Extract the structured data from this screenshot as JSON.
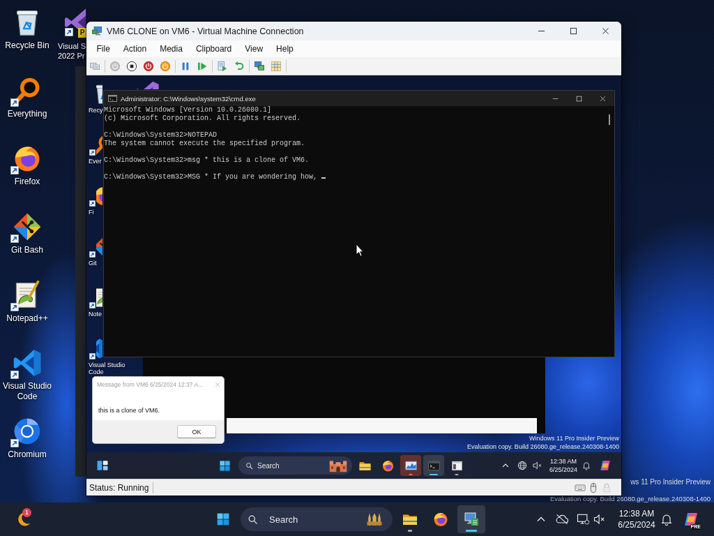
{
  "desktop": {
    "icons": [
      {
        "kind": "recycle-bin",
        "label": "Recycle Bin",
        "shortcut": false
      },
      {
        "kind": "everything",
        "label": "Everything",
        "shortcut": true
      },
      {
        "kind": "firefox",
        "label": "Firefox",
        "shortcut": true
      },
      {
        "kind": "git",
        "label": "Git Bash",
        "shortcut": true
      },
      {
        "kind": "notepad",
        "label": "Notepad++",
        "shortcut": true
      },
      {
        "kind": "vscode",
        "label": "Visual Studio Code",
        "shortcut": true
      },
      {
        "kind": "chromium",
        "label": "Chromium",
        "shortcut": true
      }
    ],
    "covered_icon": {
      "kind": "visual-studio",
      "label_lines": [
        "Visual S",
        "2022 Pr"
      ],
      "badge": "P",
      "shortcut": true
    },
    "watermark": [
      "ws 11 Pro Insider Preview",
      "Evaluation copy. Build 26080.ge_release.240308-1400"
    ]
  },
  "vm_window": {
    "title": "VM6 CLONE on VM6 - Virtual Machine Connection",
    "menu": [
      "File",
      "Action",
      "Media",
      "Clipboard",
      "View",
      "Help"
    ],
    "toolbar": [
      [
        {
          "kind": "ctrl-alt-del",
          "disabled": false
        }
      ],
      [
        {
          "kind": "start",
          "disabled": true
        },
        {
          "kind": "turn-off",
          "disabled": false
        },
        {
          "kind": "shut-down",
          "disabled": false
        },
        {
          "kind": "save",
          "disabled": false
        }
      ],
      [
        {
          "kind": "pause",
          "disabled": false
        },
        {
          "kind": "resume",
          "disabled": false
        }
      ],
      [
        {
          "kind": "checkpoint",
          "disabled": false
        },
        {
          "kind": "revert",
          "disabled": false
        }
      ],
      [
        {
          "kind": "enhanced-session",
          "disabled": false
        },
        {
          "kind": "zoom",
          "disabled": false
        }
      ]
    ],
    "status": "Status: Running",
    "status_icons": [
      {
        "kind": "keyboard",
        "disabled": false
      },
      {
        "kind": "mouse",
        "disabled": false
      },
      {
        "kind": "lock",
        "disabled": true
      }
    ]
  },
  "guest": {
    "icons": [
      {
        "kind": "recycle-bin",
        "label": "Recy",
        "shortcut": false
      },
      {
        "kind": "everything",
        "label": "Ever",
        "shortcut": true
      },
      {
        "kind": "firefox",
        "label": "Fi",
        "shortcut": true
      },
      {
        "kind": "git",
        "label": "Git",
        "shortcut": true
      },
      {
        "kind": "notepad",
        "label": "Note",
        "shortcut": true
      },
      {
        "kind": "vscode",
        "label": "Visual Studio Code",
        "shortcut": true
      }
    ],
    "covered_icon": {
      "kind": "visual-studio"
    },
    "cmd": {
      "title": "Administrator: C:\\Windows\\system32\\cmd.exe",
      "blocks": [
        [
          "Microsoft Windows [Version 10.0.26080.1]",
          "(c) Microsoft Corporation. All rights reserved."
        ],
        [
          "C:\\Windows\\System32>NOTEPAD",
          "The system cannot execute the specified program."
        ],
        [
          "C:\\Windows\\System32>msg * this is a clone of VM6."
        ],
        [
          "C:\\Windows\\System32>MSG * If you are wondering how,"
        ]
      ],
      "cursor": true
    },
    "message_box": {
      "title": "Message from VM6 6/25/2024 12:37 A...",
      "text": "this is a clone of VM6.",
      "button": "OK"
    },
    "watermark": [
      "Windows 11 Pro Insider Preview",
      "Evaluation copy. Build 26080.ge_release.240308-1400"
    ],
    "taskbar": {
      "search": {
        "placeholder": "Search"
      },
      "apps": [
        {
          "kind": "folder",
          "running": false,
          "selected": false,
          "attention": false
        },
        {
          "kind": "firefox",
          "running": false,
          "selected": false,
          "attention": false
        },
        {
          "kind": "monitor-chart",
          "running": true,
          "selected": false,
          "attention": true
        },
        {
          "kind": "terminal",
          "running": true,
          "selected": true,
          "attention": false
        },
        {
          "kind": "window-app",
          "running": true,
          "selected": false,
          "attention": false
        }
      ],
      "time": "12:38 AM",
      "date": "6/25/2024"
    }
  },
  "taskbar": {
    "widget_badge": "1",
    "search": {
      "placeholder": "Search"
    },
    "apps": [
      {
        "kind": "folder",
        "running": true,
        "selected": false,
        "attention": false
      },
      {
        "kind": "firefox",
        "running": false,
        "selected": false,
        "attention": false
      },
      {
        "kind": "hyper-v",
        "running": true,
        "selected": true,
        "attention": false
      }
    ],
    "time": "12:38 AM",
    "date": "6/25/2024",
    "copilot_badge": "PRE"
  }
}
